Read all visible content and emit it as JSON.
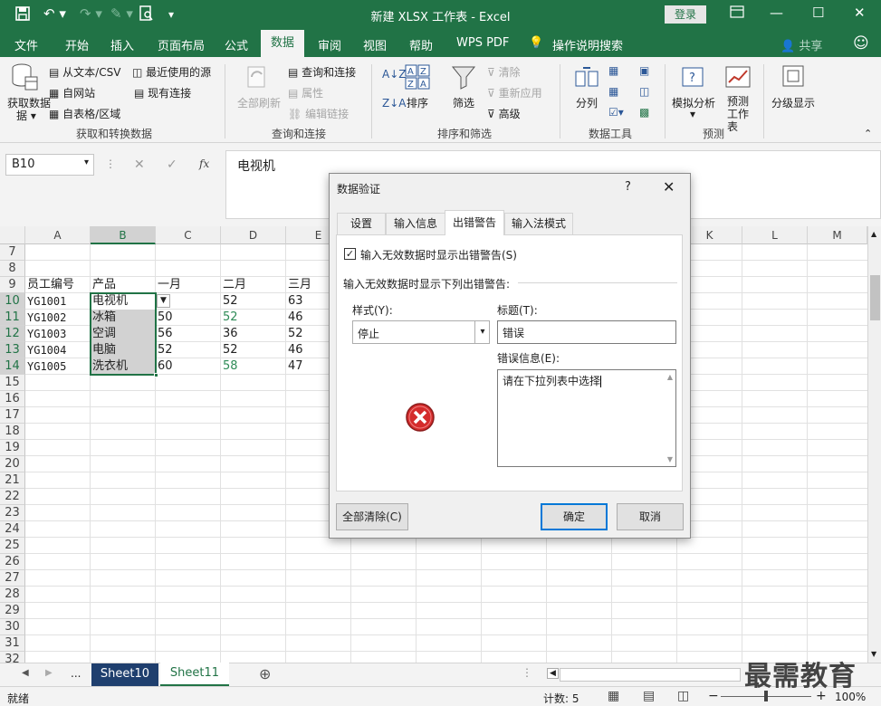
{
  "window": {
    "title": "新建 XLSX 工作表 - Excel",
    "login": "登录",
    "share": "共享"
  },
  "menu": {
    "tabs": [
      "文件",
      "开始",
      "插入",
      "页面布局",
      "公式",
      "数据",
      "审阅",
      "视图",
      "帮助",
      "WPS PDF"
    ],
    "tell_me": "操作说明搜索",
    "active": "数据"
  },
  "ribbon": {
    "get_data": {
      "btn": "获取数据",
      "from_text": "从文本/CSV",
      "from_web": "自网站",
      "from_table": "自表格/区域",
      "recent": "最近使用的源",
      "existing": "现有连接",
      "group": "获取和转换数据"
    },
    "queries": {
      "refresh_all": "全部刷新",
      "queries_conn": "查询和连接",
      "properties": "属性",
      "edit_links": "编辑链接",
      "group": "查询和连接"
    },
    "sort": {
      "sort": "排序",
      "filter": "筛选",
      "clear": "清除",
      "reapply": "重新应用",
      "advanced": "高级",
      "group": "排序和筛选"
    },
    "tools": {
      "split": "分列",
      "group": "数据工具"
    },
    "forecast": {
      "whatif": "模拟分析",
      "sheet": "预测工作表",
      "group": "预测"
    },
    "outline": {
      "label": "分级显示"
    }
  },
  "formula_bar": {
    "name_box": "B10",
    "content": "电视机"
  },
  "columns": [
    "A",
    "B",
    "C",
    "D",
    "E",
    "L",
    "M"
  ],
  "hidden_col_K": "K",
  "rows": [
    "7",
    "8",
    "9",
    "10",
    "11",
    "12",
    "13",
    "14",
    "15",
    "16",
    "17",
    "18",
    "19",
    "20",
    "21",
    "22",
    "23",
    "24",
    "25",
    "26",
    "27",
    "28",
    "29",
    "30",
    "31",
    "32"
  ],
  "table": {
    "header": [
      "员工编号",
      "产品",
      "一月",
      "二月",
      "三月"
    ],
    "data": [
      [
        "YG1001",
        "电视机",
        "",
        "52",
        "63"
      ],
      [
        "YG1002",
        "冰箱",
        "50",
        "52",
        "46"
      ],
      [
        "YG1003",
        "空调",
        "56",
        "36",
        "52"
      ],
      [
        "YG1004",
        "电脑",
        "52",
        "52",
        "46"
      ],
      [
        "YG1005",
        "洗衣机",
        "60",
        "58",
        "47"
      ]
    ]
  },
  "dialog": {
    "title": "数据验证",
    "help": "?",
    "tabs": [
      "设置",
      "输入信息",
      "出错警告",
      "输入法模式"
    ],
    "active_tab": "出错警告",
    "checkbox_label": "输入无效数据时显示出错警告(S)",
    "checkbox_checked": true,
    "section_label": "输入无效数据时显示下列出错警告:",
    "style_label": "样式(Y):",
    "style_value": "停止",
    "title_label": "标题(T):",
    "title_value": "错误",
    "message_label": "错误信息(E):",
    "message_value": "请在下拉列表中选择",
    "clear_all": "全部清除(C)",
    "ok": "确定",
    "cancel": "取消"
  },
  "sheets": {
    "tabs": [
      "Sheet10",
      "Sheet11"
    ],
    "ellipsis": "..."
  },
  "status": {
    "ready": "就绪",
    "count": "计数: 5",
    "zoom": "100%"
  },
  "watermark": "最需教育",
  "colors": {
    "excel_green": "#217346",
    "selection": "#d2d2d2",
    "green_text": "#2e8b57"
  }
}
